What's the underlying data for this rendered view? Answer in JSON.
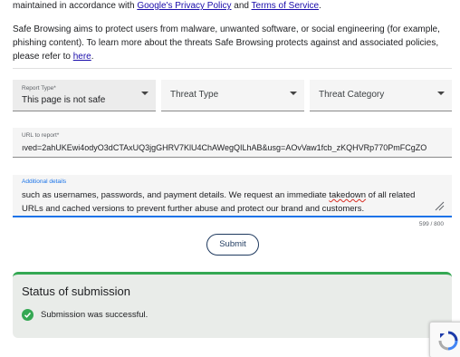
{
  "intro": {
    "prefix": "maintained in accordance with ",
    "privacy_link": "Google's Privacy Policy",
    "and_text": " and ",
    "terms_link": "Terms of Service",
    "suffix": "."
  },
  "description": {
    "text": "Safe Browsing aims to protect users from malware, unwanted software, or social engineering (for example, phishing content). To learn more about the threats Safe Browsing protects against and associated policies, please refer to ",
    "link": "here",
    "suffix": "."
  },
  "form": {
    "report_type": {
      "label": "Report Type*",
      "value": "This page is not safe"
    },
    "threat_type": {
      "placeholder": "Threat Type"
    },
    "threat_category": {
      "placeholder": "Threat Category"
    },
    "url": {
      "label": "URL to report*",
      "value": "ıved=2ahUKEwi4odyO3dCTAxUQ3jgGHRV7KlU4ChAWegQILhAB&usg=AOvVaw1fcb_zKQHVRp770PmFCgZO"
    },
    "details": {
      "label": "Additional details",
      "line1_before": "such as usernames, passwords, and payment details. We request an immediate ",
      "line1_misspelled": "takedown",
      "line1_after": " of all related",
      "line2": "URLs and cached versions to prevent further abuse and protect our brand and customers.",
      "counter": "599 / 800"
    },
    "submit_label": "Submit"
  },
  "status": {
    "title": "Status of submission",
    "message": "Submission was successful.",
    "accent_color": "#34a853"
  },
  "icons": {
    "dropdown": "chevron-down-icon",
    "success": "check-circle-icon",
    "resize": "resize-handle-icon",
    "captcha": "recaptcha-icon"
  }
}
